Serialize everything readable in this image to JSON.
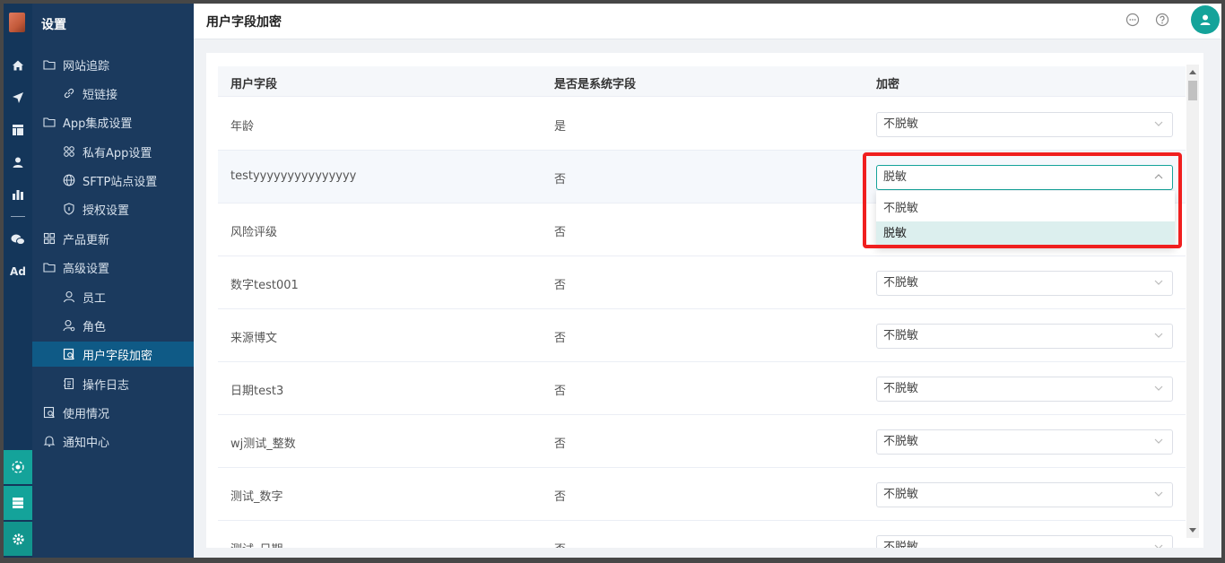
{
  "sidebar": {
    "title": "设置",
    "items": [
      {
        "label": "网站追踪",
        "icon": "folder-icon"
      },
      {
        "label": "短链接",
        "icon": "link-icon"
      },
      {
        "label": "App集成设置",
        "icon": "folder-icon"
      },
      {
        "label": "私有App设置",
        "icon": "apps-icon"
      },
      {
        "label": "SFTP站点设置",
        "icon": "globe-icon"
      },
      {
        "label": "授权设置",
        "icon": "shield-icon"
      },
      {
        "label": "产品更新",
        "icon": "grid-icon"
      },
      {
        "label": "高级设置",
        "icon": "folder-icon"
      },
      {
        "label": "员工",
        "icon": "user-icon"
      },
      {
        "label": "角色",
        "icon": "role-icon"
      },
      {
        "label": "用户字段加密",
        "icon": "encrypt-doc-icon",
        "active": true
      },
      {
        "label": "操作日志",
        "icon": "log-icon"
      },
      {
        "label": "使用情况",
        "icon": "usage-icon"
      },
      {
        "label": "通知中心",
        "icon": "bell-icon"
      }
    ]
  },
  "rail": {
    "icons": [
      "home-icon",
      "send-icon",
      "layout-icon",
      "contacts-icon",
      "bar-chart-icon",
      "wechat-icon",
      "ad-icon",
      "hub-icon",
      "server-icon",
      "gear-icon"
    ],
    "ad_label": "Ad"
  },
  "header": {
    "title": "用户字段加密",
    "icons": [
      "chat-icon",
      "help-icon",
      "avatar-icon"
    ]
  },
  "table": {
    "headers": [
      "用户字段",
      "是否是系统字段",
      "加密"
    ],
    "rows": [
      {
        "field": "年龄",
        "system": "是",
        "encrypt": "不脱敏"
      },
      {
        "field": "testyyyyyyyyyyyyyyy",
        "system": "否",
        "encrypt": "脱敏"
      },
      {
        "field": "风险评级",
        "system": "否",
        "encrypt": ""
      },
      {
        "field": "数字test001",
        "system": "否",
        "encrypt": "不脱敏"
      },
      {
        "field": "来源博文",
        "system": "否",
        "encrypt": "不脱敏"
      },
      {
        "field": "日期test3",
        "system": "否",
        "encrypt": "不脱敏"
      },
      {
        "field": "wj测试_整数",
        "system": "否",
        "encrypt": "不脱敏"
      },
      {
        "field": "测试_数字",
        "system": "否",
        "encrypt": "不脱敏"
      },
      {
        "field": "测试_日期",
        "system": "否",
        "encrypt": "不脱敏"
      }
    ]
  },
  "dropdown": {
    "options": [
      "不脱敏",
      "脱敏"
    ],
    "selected": "脱敏"
  },
  "colors": {
    "accent": "#14a39a",
    "sidebar_bg": "#1b3a5e",
    "rail_bg": "#14365a",
    "active_item": "#0f5a86",
    "highlight_box": "#f01f1f"
  }
}
